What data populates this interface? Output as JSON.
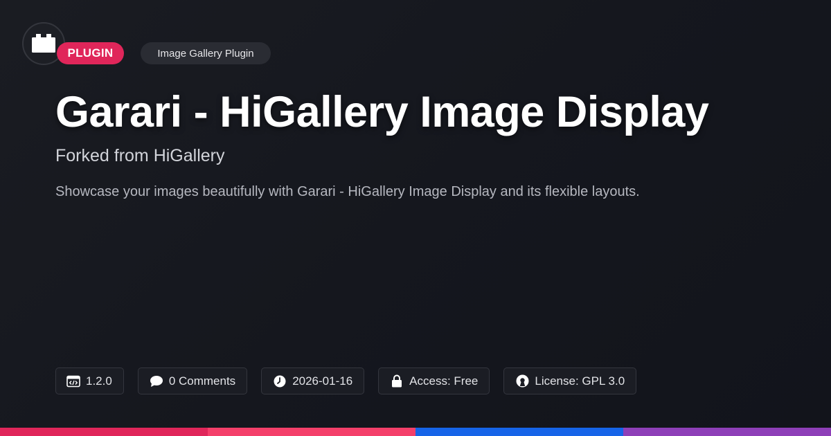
{
  "badge": {
    "type_label": "PLUGIN",
    "category_label": "Image Gallery Plugin"
  },
  "header": {
    "title": "Garari - HiGallery Image Display",
    "subtitle": "Forked from HiGallery",
    "description": "Showcase your images beautifully with Garari - HiGallery Image Display and its flexible layouts."
  },
  "meta": {
    "version": "1.2.0",
    "comments": "0 Comments",
    "date": "2026-01-16",
    "access": "Access: Free",
    "license": "License: GPL 3.0"
  },
  "icons": {
    "logo": "plugin-brick-icon",
    "version": "code-window-icon",
    "comments": "speech-bubble-icon",
    "date": "clock-icon",
    "access": "lock-icon",
    "license": "open-source-icon"
  },
  "colors": {
    "accent": "#e0265a",
    "bar_segments": [
      "#e0265a",
      "#f43f6a",
      "#1664e8",
      "#8e3fb8"
    ]
  }
}
